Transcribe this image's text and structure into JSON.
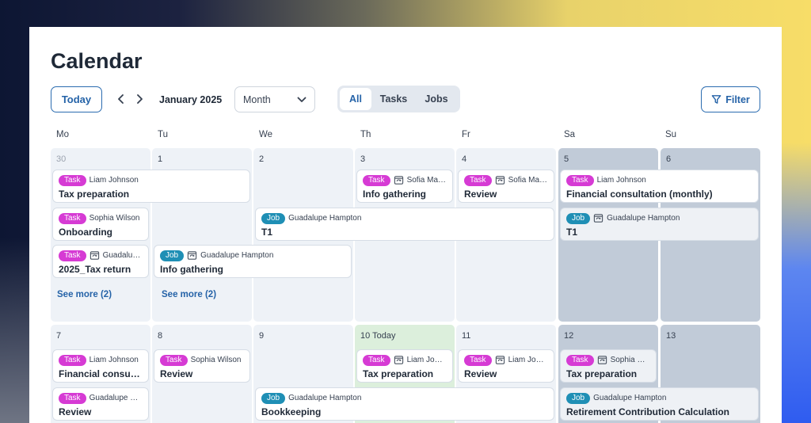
{
  "page": {
    "title": "Calendar"
  },
  "toolbar": {
    "today_label": "Today",
    "month_label": "January 2025",
    "view_select": "Month",
    "segments": [
      "All",
      "Tasks",
      "Jobs"
    ],
    "filter_label": "Filter"
  },
  "weekdays": [
    "Mo",
    "Tu",
    "We",
    "Th",
    "Fr",
    "Sa",
    "Su"
  ],
  "weeks": [
    {
      "days": [
        "30",
        "1",
        "2",
        "3",
        "4",
        "5",
        "6"
      ]
    },
    {
      "days": [
        "7",
        "8",
        "9",
        "10 Today",
        "11",
        "12",
        "13"
      ]
    }
  ],
  "events": [
    {
      "type": "Task",
      "person": "Liam Johnson",
      "title": "Tax preparation"
    },
    {
      "type": "Task",
      "person": "Sofia Marti…",
      "title": "Info gathering"
    },
    {
      "type": "Task",
      "person": "Sofia Marti…",
      "title": "Review"
    },
    {
      "type": "Task",
      "person": "Liam Johnson",
      "title": "Financial consultation (monthly)"
    },
    {
      "type": "Task",
      "person": "Sophia Wilson",
      "title": "Onboarding"
    },
    {
      "type": "Job",
      "person": "Guadalupe Hampton",
      "title": "T1"
    },
    {
      "type": "Job",
      "person": "Guadalupe Hampton",
      "title": "T1"
    },
    {
      "type": "Task",
      "person": "Guadalup…",
      "title": "2025_Tax return"
    },
    {
      "type": "Job",
      "person": "Guadalupe Hampton",
      "title": "Info gathering"
    },
    {
      "type": "Task",
      "person": "Liam Johnson",
      "title": "Financial consultat…"
    },
    {
      "type": "Task",
      "person": "Sophia Wilson",
      "title": "Review"
    },
    {
      "type": "Task",
      "person": "Liam John…",
      "title": "Tax preparation"
    },
    {
      "type": "Task",
      "person": "Liam John…",
      "title": "Review"
    },
    {
      "type": "Task",
      "person": "Sophia Wil…",
      "title": "Tax preparation"
    },
    {
      "type": "Task",
      "person": "Guadalupe Ha…",
      "title": "Review"
    },
    {
      "type": "Job",
      "person": "Guadalupe Hampton",
      "title": "Bookkeeping"
    },
    {
      "type": "Job",
      "person": "Guadalupe Hampton",
      "title": "Retirement Contribution Calculation"
    }
  ],
  "see_more": [
    "See more (2)",
    "See more (2)"
  ]
}
